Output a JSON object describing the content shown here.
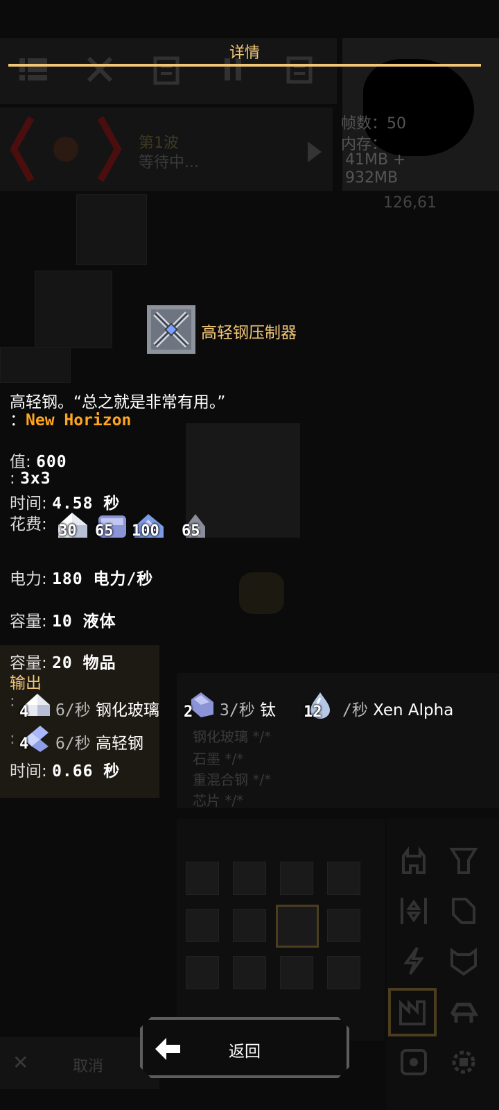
{
  "dialog": {
    "title": "详情",
    "block_name": "高轻钢压制器",
    "description": "高轻钢。“总之就是非常有用。”",
    "mod_prefix": "：",
    "mod_name": "New Horizon",
    "stats": {
      "health_label": "值:",
      "health_value": "600",
      "size_label": ":",
      "size_value": "3x3",
      "build_time_label": "时间:",
      "build_time_value": "4.58 秒",
      "cost_label": "花费:",
      "costs": [
        "30",
        "65",
        "100",
        "65"
      ],
      "power_label": "电力:",
      "power_value": "180 电力/秒",
      "liquid_cap_label": "容量:",
      "liquid_cap_value": "10 液体",
      "item_cap_label": "容量:",
      "item_cap_value": "20 物品"
    },
    "output_header": "输出",
    "inputs": [
      {
        "count": "4",
        "rate": "6/秒",
        "name": "钢化玻璃"
      },
      {
        "count": "2",
        "rate": "3/秒",
        "name": "钛"
      },
      {
        "count": "12",
        "rate": "/秒",
        "name": "Xen Alpha"
      }
    ],
    "output": {
      "count": "4",
      "rate": "6/秒",
      "name": "高轻钢"
    },
    "craft_time_label": "时间:",
    "craft_time_value": "0.66 秒",
    "back_label": "返回"
  },
  "background": {
    "wave_label": "第1波",
    "wave_status": "等待中...",
    "fps_label": "帧数：50",
    "memory_label": "内存：",
    "memory_value_1": "41MB +",
    "memory_value_2": "932MB",
    "coords": "126,61",
    "popup_lines": [
      "钢化玻璃 */*",
      "石墨 */*",
      "重混合钢 */*",
      "芯片 */*"
    ],
    "cancel_label": "取消"
  },
  "colors": {
    "accent": "#f2c777",
    "mod_orange": "#ffa61f",
    "background": "#0b0b0b"
  }
}
